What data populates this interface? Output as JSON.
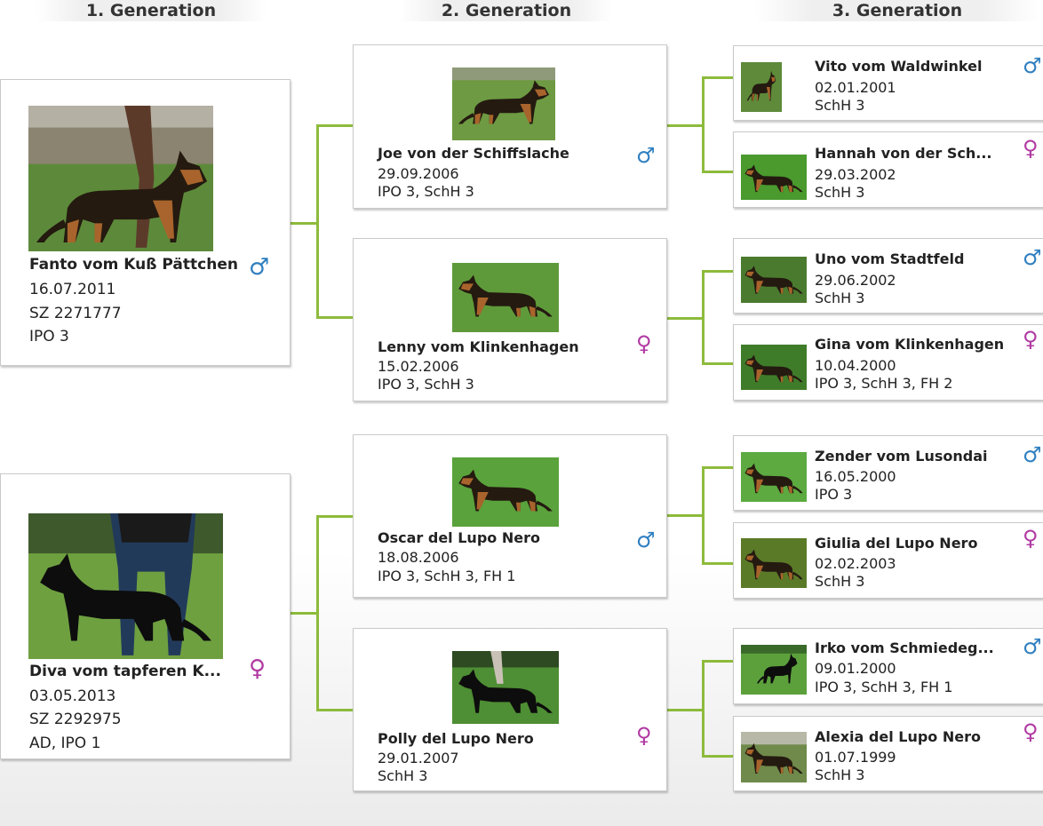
{
  "headers": [
    "1. Generation",
    "2. Generation",
    "3. Generation"
  ],
  "colors": {
    "male": "#2f7fc0",
    "female": "#b03aa2",
    "connector": "#8dbb3c"
  },
  "male_symbol": "♂",
  "female_symbol": "♀",
  "gen1": [
    {
      "name": "Fanto vom Kuß Pättchen",
      "date": "16.07.2011",
      "reg": "SZ 2271777",
      "titles": "IPO 3",
      "sex": "male",
      "photo": "dog-black-tan-with-handler"
    },
    {
      "name": "Diva vom tapferen K...",
      "date": "03.05.2013",
      "reg": "SZ 2292975",
      "titles": "AD, IPO 1",
      "sex": "female",
      "photo": "dog-black-with-handler"
    }
  ],
  "gen2": [
    {
      "name": "Joe von der Schiffslache",
      "date": "29.09.2006",
      "titles": "IPO 3, SchH 3",
      "sex": "male",
      "photo": "dog-black-tan"
    },
    {
      "name": "Lenny vom Klinkenhagen",
      "date": "15.02.2006",
      "titles": "IPO 3, SchH 3",
      "sex": "female",
      "photo": "dog-black-tan"
    },
    {
      "name": "Oscar del Lupo Nero",
      "date": "18.08.2006",
      "titles": "IPO 3, SchH 3, FH 1",
      "sex": "male",
      "photo": "dog-black-tan"
    },
    {
      "name": "Polly del Lupo Nero",
      "date": "29.01.2007",
      "titles": "SchH 3",
      "sex": "female",
      "photo": "dog-black"
    }
  ],
  "gen3": [
    {
      "name": "Vito vom Waldwinkel",
      "date": "02.01.2001",
      "titles": "SchH 3",
      "sex": "male",
      "photo": "dog-black-tan"
    },
    {
      "name": "Hannah von der Sch...",
      "date": "29.03.2002",
      "titles": "SchH 3",
      "sex": "female",
      "photo": "dog-black-tan"
    },
    {
      "name": "Uno vom Stadtfeld",
      "date": "29.06.2002",
      "titles": "SchH 3",
      "sex": "male",
      "photo": "dog-black-tan"
    },
    {
      "name": "Gina vom Klinkenhagen",
      "date": "10.04.2000",
      "titles": "IPO 3, SchH 3, FH 2",
      "sex": "female",
      "photo": "dog-black-tan"
    },
    {
      "name": "Zender vom Lusondai",
      "date": "16.05.2000",
      "titles": "IPO 3",
      "sex": "male",
      "photo": "dog-black-tan"
    },
    {
      "name": "Giulia del Lupo Nero",
      "date": "02.02.2003",
      "titles": "SchH 3",
      "sex": "female",
      "photo": "dog-black-tan"
    },
    {
      "name": "Irko vom Schmiedeg...",
      "date": "09.01.2000",
      "titles": "IPO 3, SchH 3, FH 1",
      "sex": "male",
      "photo": "dog-black"
    },
    {
      "name": "Alexia del Lupo Nero",
      "date": "01.07.1999",
      "titles": "SchH 3",
      "sex": "female",
      "photo": "dog-black-tan"
    }
  ]
}
